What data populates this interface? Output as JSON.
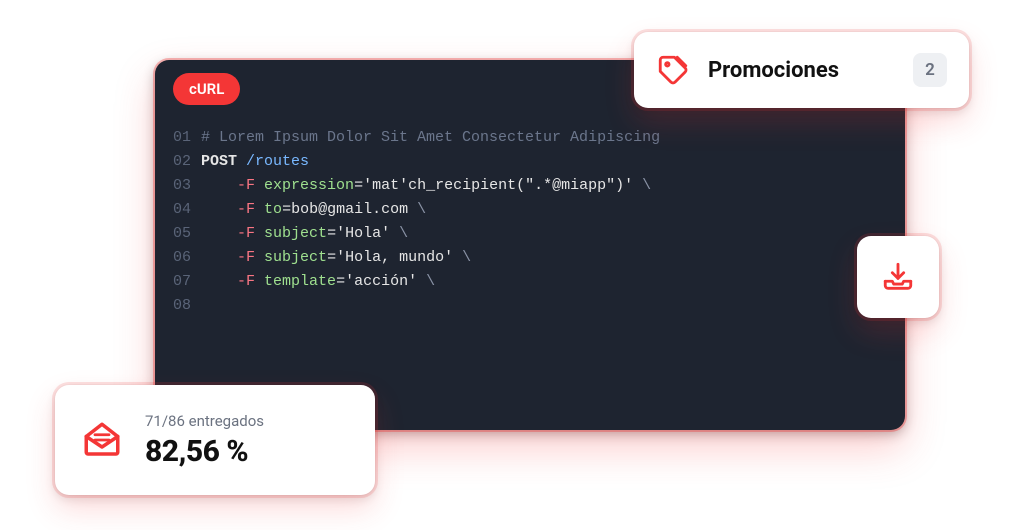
{
  "code": {
    "language_pill": "cURL",
    "line_numbers": [
      "01",
      "02",
      "03",
      "04",
      "05",
      "06",
      "07",
      "08"
    ],
    "comment": "# Lorem Ipsum Dolor Sit Amet Consectetur Adipiscing",
    "method": "POST",
    "path": "/routes",
    "flags": [
      {
        "flag": "-F",
        "key": "expression",
        "val": "='mat'ch_recipient(\".*@miapp\")'",
        "bs": " \\"
      },
      {
        "flag": "-F",
        "key": "to",
        "val": "=bob@gmail.com",
        "bs": " \\"
      },
      {
        "flag": "-F",
        "key": "subject",
        "val": "='Hola'",
        "bs": " \\"
      },
      {
        "flag": "-F",
        "key": "subject",
        "val": "='Hola, mundo'",
        "bs": " \\"
      },
      {
        "flag": "-F",
        "key": "template",
        "val": "='acción'",
        "bs": " \\"
      }
    ]
  },
  "promo": {
    "label": "Promociones",
    "count": "2"
  },
  "delivered": {
    "subtitle": "71/86 entregados",
    "percent": "82,56 %"
  },
  "colors": {
    "accent": "#f43636"
  }
}
